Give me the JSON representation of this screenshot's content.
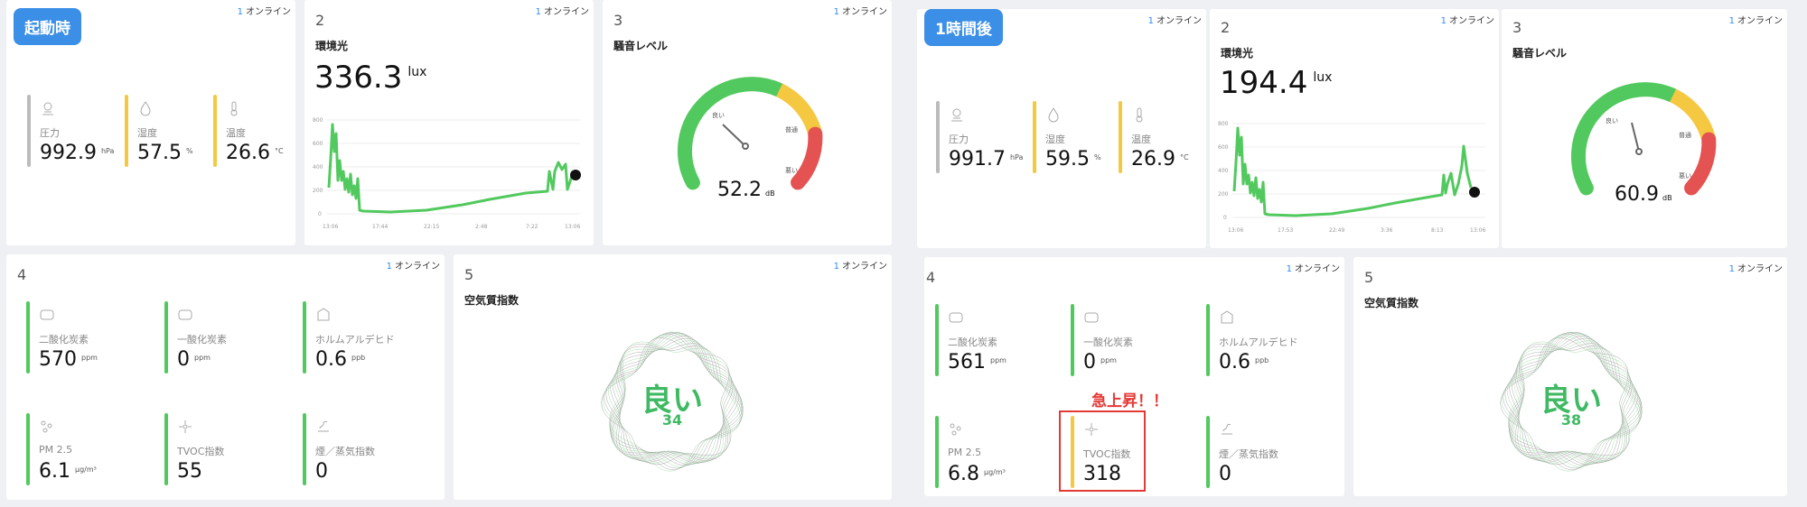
{
  "colors": {
    "green": "#52c95e",
    "yellow": "#f5c842",
    "red": "#e45252",
    "gray": "#bbbbbb",
    "badge": "#3b8fe6",
    "alert": "#e53935"
  },
  "panels": {
    "left": {
      "badge": "起動時",
      "card1": {
        "online_count": "1",
        "online_label": "オンライン",
        "metrics": [
          {
            "label": "圧力",
            "value": "992.9",
            "unit": "hPa",
            "icon": "gauge-icon"
          },
          {
            "label": "湿度",
            "value": "57.5",
            "unit": "%",
            "icon": "humidity-icon"
          },
          {
            "label": "温度",
            "value": "26.6",
            "unit": "°C",
            "icon": "thermometer-icon"
          }
        ]
      },
      "card2": {
        "number": "2",
        "online_count": "1",
        "online_label": "オンライン",
        "title": "環境光",
        "value": "336.3",
        "unit": "lux",
        "chart_ticks_y": [
          "800",
          "600",
          "400",
          "200",
          "0"
        ],
        "chart_ticks_x": [
          "13:06",
          "17:44",
          "22:15",
          "2:48",
          "7:22",
          "13:06"
        ]
      },
      "card3": {
        "number": "3",
        "online_count": "1",
        "online_label": "オンライン",
        "title": "騒音レベル",
        "value": "52.2",
        "unit": "dB",
        "gauge_labels": [
          "良い",
          "普通",
          "悪い"
        ],
        "gauge_level": 0.42
      },
      "card4": {
        "number": "4",
        "online_count": "1",
        "online_label": "オンライン",
        "metrics": [
          {
            "label": "二酸化炭素",
            "value": "570",
            "unit": "ppm",
            "icon": "co2-icon"
          },
          {
            "label": "一酸化炭素",
            "value": "0",
            "unit": "ppm",
            "icon": "co-icon"
          },
          {
            "label": "ホルムアルデヒド",
            "value": "0.6",
            "unit": "ppb",
            "icon": "formaldehyde-icon"
          },
          {
            "label": "PM 2.5",
            "value": "6.1",
            "unit": "μg/m³",
            "icon": "particle-icon"
          },
          {
            "label": "TVOC指数",
            "value": "55",
            "unit": "",
            "icon": "tvoc-icon"
          },
          {
            "label": "煙／蒸気指数",
            "value": "0",
            "unit": "",
            "icon": "smoke-icon"
          }
        ]
      },
      "card5": {
        "number": "5",
        "online_count": "1",
        "online_label": "オンライン",
        "title": "空気質指数",
        "label": "良い",
        "value": "34"
      }
    },
    "right": {
      "badge": "1時間後",
      "card1": {
        "online_count": "1",
        "online_label": "オンライン",
        "metrics": [
          {
            "label": "圧力",
            "value": "991.7",
            "unit": "hPa",
            "icon": "gauge-icon"
          },
          {
            "label": "湿度",
            "value": "59.5",
            "unit": "%",
            "icon": "humidity-icon"
          },
          {
            "label": "温度",
            "value": "26.9",
            "unit": "°C",
            "icon": "thermometer-icon"
          }
        ]
      },
      "card2": {
        "number": "2",
        "online_count": "1",
        "online_label": "オンライン",
        "title": "環境光",
        "value": "194.4",
        "unit": "lux",
        "chart_ticks_y": [
          "800",
          "600",
          "400",
          "200",
          "0"
        ],
        "chart_ticks_x": [
          "13:06",
          "17:53",
          "22:49",
          "3:36",
          "8:13",
          "13:06"
        ]
      },
      "card3": {
        "number": "3",
        "online_count": "1",
        "online_label": "オンライン",
        "title": "騒音レベル",
        "value": "60.9",
        "unit": "dB",
        "gauge_labels": [
          "良い",
          "普通",
          "悪い"
        ],
        "gauge_level": 0.47
      },
      "card4": {
        "number": "4",
        "online_count": "1",
        "online_label": "オンライン",
        "metrics": [
          {
            "label": "二酸化炭素",
            "value": "561",
            "unit": "ppm",
            "icon": "co2-icon"
          },
          {
            "label": "一酸化炭素",
            "value": "0",
            "unit": "ppm",
            "icon": "co-icon"
          },
          {
            "label": "ホルムアルデヒド",
            "value": "0.6",
            "unit": "ppb",
            "icon": "formaldehyde-icon"
          },
          {
            "label": "PM 2.5",
            "value": "6.8",
            "unit": "μg/m³",
            "icon": "particle-icon"
          },
          {
            "label": "TVOC指数",
            "value": "318",
            "unit": "",
            "icon": "tvoc-icon"
          },
          {
            "label": "煙／蒸気指数",
            "value": "0",
            "unit": "",
            "icon": "smoke-icon"
          }
        ],
        "alert": "急上昇！！"
      },
      "card5": {
        "number": "5",
        "online_count": "1",
        "online_label": "オンライン",
        "title": "空気質指数",
        "label": "良い",
        "value": "38"
      }
    }
  }
}
